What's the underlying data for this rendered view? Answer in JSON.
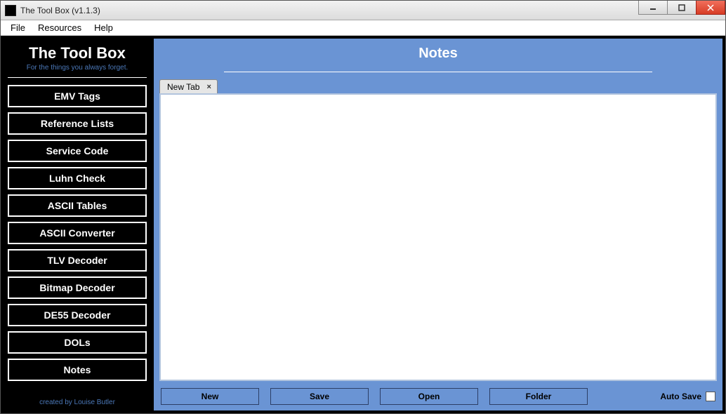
{
  "window": {
    "title": "The Tool Box (v1.1.3)"
  },
  "menubar": {
    "items": [
      "File",
      "Resources",
      "Help"
    ]
  },
  "sidebar": {
    "brand_title": "The Tool Box",
    "brand_sub": "For the things you always forget.",
    "items": [
      "EMV Tags",
      "Reference Lists",
      "Service Code",
      "Luhn Check",
      "ASCII Tables",
      "ASCII Converter",
      "TLV Decoder",
      "Bitmap Decoder",
      "DE55 Decoder",
      "DOLs",
      "Notes"
    ],
    "credit": "created by Louise Butler"
  },
  "main": {
    "title": "Notes",
    "tab_label": "New Tab",
    "tab_close": "×",
    "editor_value": "",
    "buttons": {
      "new": "New",
      "save": "Save",
      "open": "Open",
      "folder": "Folder"
    },
    "autosave_label": "Auto Save"
  }
}
